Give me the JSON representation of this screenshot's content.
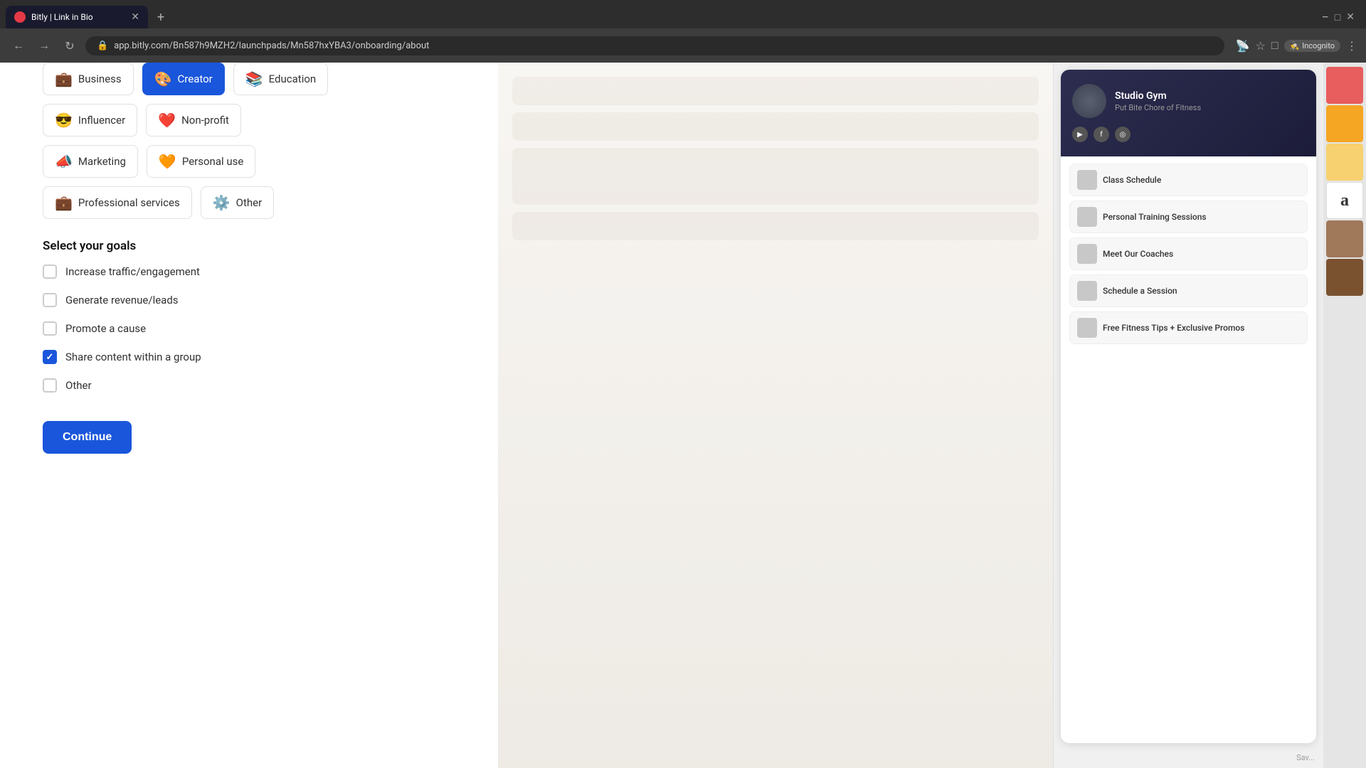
{
  "browser": {
    "tab_title": "Bitly | Link in Bio",
    "tab_favicon": "🔗",
    "url": "app.bitly.com/Bn587h9MZH2/launchpads/Mn587hxYBA3/onboarding/about",
    "incognito_label": "Incognito"
  },
  "categories": [
    {
      "id": "business",
      "emoji": "💼",
      "label": "Business",
      "selected": false
    },
    {
      "id": "creator",
      "emoji": "🎨",
      "label": "Creator",
      "selected": true
    },
    {
      "id": "education",
      "emoji": "📚",
      "label": "Education",
      "selected": false
    },
    {
      "id": "influencer",
      "emoji": "😎",
      "label": "Influencer",
      "selected": false
    },
    {
      "id": "non-profit",
      "emoji": "❤️",
      "label": "Non-profit",
      "selected": false
    },
    {
      "id": "marketing",
      "emoji": "📣",
      "label": "Marketing",
      "selected": false
    },
    {
      "id": "personal-use",
      "emoji": "🧡",
      "label": "Personal use",
      "selected": false
    },
    {
      "id": "professional-services",
      "emoji": "💼",
      "label": "Professional services",
      "selected": false
    },
    {
      "id": "other",
      "emoji": "⚙️",
      "label": "Other",
      "selected": false
    }
  ],
  "goals_section": {
    "title": "Select your goals",
    "goals": [
      {
        "id": "traffic",
        "label": "Increase traffic/engagement",
        "checked": false
      },
      {
        "id": "revenue",
        "label": "Generate revenue/leads",
        "checked": false
      },
      {
        "id": "cause",
        "label": "Promote a cause",
        "checked": false
      },
      {
        "id": "share-content",
        "label": "Share content within a group",
        "checked": true
      },
      {
        "id": "other",
        "label": "Other",
        "checked": false
      }
    ]
  },
  "continue_button": {
    "label": "Continue"
  },
  "preview": {
    "studio_name": "Studio Gym",
    "tagline": "Put Bite Chore of Fitness",
    "links": [
      {
        "label": "Class Schedule"
      },
      {
        "label": "Personal Training Sessions"
      },
      {
        "label": "Meet Our Coaches"
      },
      {
        "label": "Schedule a Session"
      },
      {
        "label": "Free Fitness Tips + Exclusive Promos"
      }
    ]
  }
}
